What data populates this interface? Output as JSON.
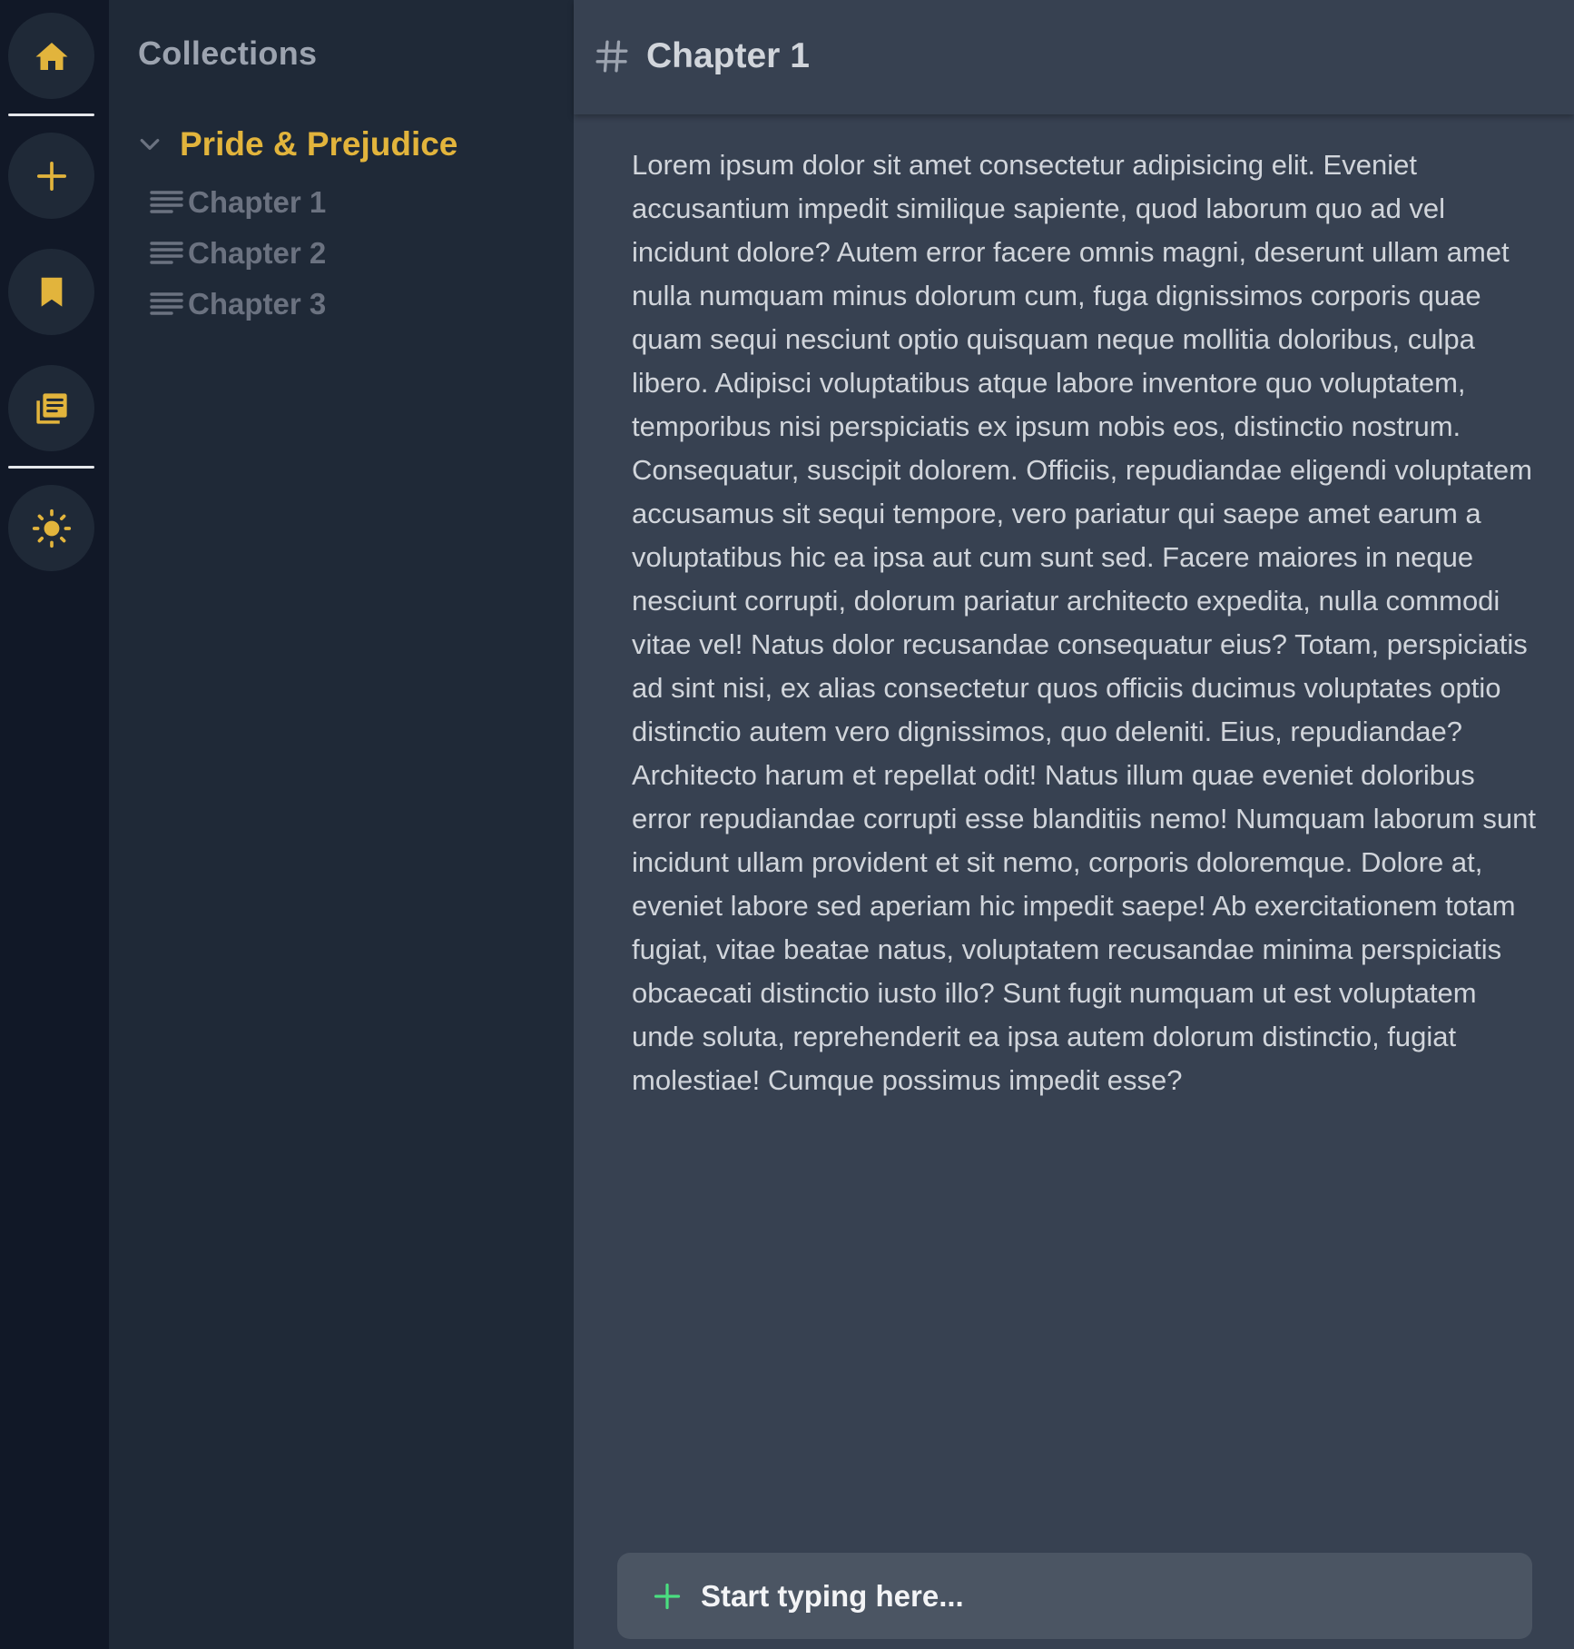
{
  "colors": {
    "accent": "#e2b43c",
    "rail_bg": "#111827",
    "panel_bg": "#1f2937",
    "main_bg": "#374151",
    "composer_bg": "#4b5563",
    "add_green": "#4ade80"
  },
  "rail": {
    "buttons": [
      {
        "icon": "home-icon"
      },
      {
        "icon": "plus-icon"
      },
      {
        "icon": "bookmark-icon"
      },
      {
        "icon": "library-icon"
      },
      {
        "icon": "sun-icon"
      }
    ]
  },
  "sidebar": {
    "title": "Collections",
    "collection": {
      "name": "Pride & Prejudice",
      "expanded": true,
      "chapters": [
        {
          "label": "Chapter 1"
        },
        {
          "label": "Chapter 2"
        },
        {
          "label": "Chapter 3"
        }
      ]
    }
  },
  "main": {
    "title": "Chapter 1",
    "body": "Lorem ipsum dolor sit amet consectetur adipisicing elit. Eveniet accusantium impedit similique sapiente, quod laborum quo ad vel incidunt dolore? Autem error facere omnis magni, deserunt ullam amet nulla numquam minus dolorum cum, fuga dignissimos corporis quae quam sequi nesciunt optio quisquam neque mollitia doloribus, culpa libero. Adipisci voluptatibus atque labore inventore quo voluptatem, temporibus nisi perspiciatis ex ipsum nobis eos, distinctio nostrum. Consequatur, suscipit dolorem. Officiis, repudiandae eligendi voluptatem accusamus sit sequi tempore, vero pariatur qui saepe amet earum a voluptatibus hic ea ipsa aut cum sunt sed. Facere maiores in neque nesciunt corrupti, dolorum pariatur architecto expedita, nulla commodi vitae vel! Natus dolor recusandae consequatur eius? Totam, perspiciatis ad sint nisi, ex alias consectetur quos officiis ducimus voluptates optio distinctio autem vero dignissimos, quo deleniti. Eius, repudiandae? Architecto harum et repellat odit! Natus illum quae eveniet doloribus error repudiandae corrupti esse blanditiis nemo! Numquam laborum sunt incidunt ullam provident et sit nemo, corporis doloremque. Dolore at, eveniet labore sed aperiam hic impedit saepe! Ab exercitationem totam fugiat, vitae beatae natus, voluptatem recusandae minima perspiciatis obcaecati distinctio iusto illo? Sunt fugit numquam ut est voluptatem unde soluta, reprehenderit ea ipsa autem dolorum distinctio, fugiat molestiae! Cumque possimus impedit esse?",
    "composer": {
      "placeholder": "Start typing here..."
    }
  }
}
